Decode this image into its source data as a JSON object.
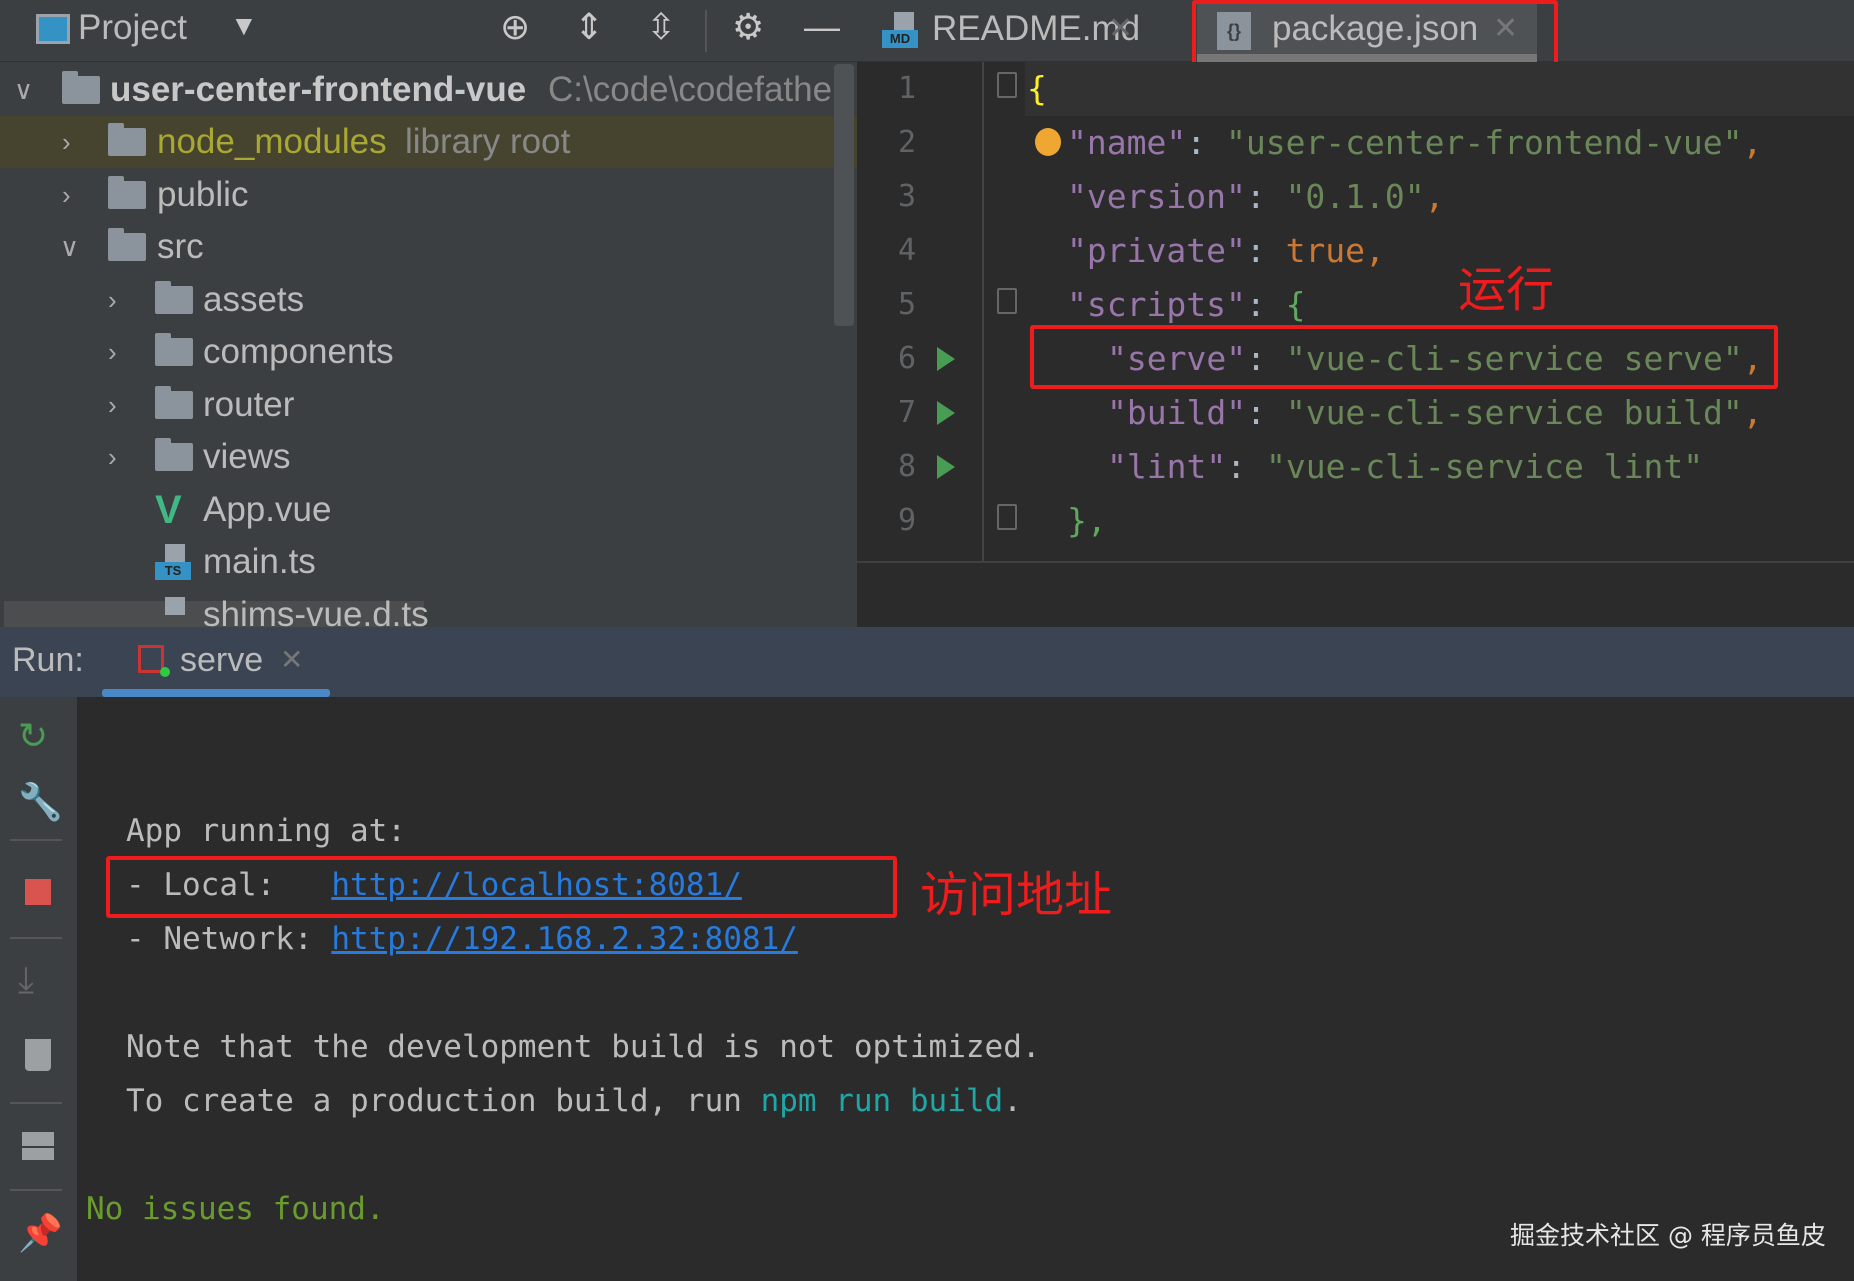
{
  "project_panel": {
    "title": "Project",
    "toolbar_icons": [
      "locate-icon",
      "expand-all-icon",
      "collapse-all-icon",
      "gear-icon",
      "minimize-icon"
    ],
    "tree": [
      {
        "label": "user-center-frontend-vue",
        "hint": "C:\\code\\codefather",
        "type": "folder",
        "expanded": true,
        "level": 0
      },
      {
        "label": "node_modules",
        "hint": "library root",
        "type": "folder",
        "expanded": false,
        "level": 1
      },
      {
        "label": "public",
        "type": "folder",
        "expanded": false,
        "level": 1
      },
      {
        "label": "src",
        "type": "folder",
        "expanded": true,
        "level": 1
      },
      {
        "label": "assets",
        "type": "folder",
        "expanded": false,
        "level": 2
      },
      {
        "label": "components",
        "type": "folder",
        "expanded": false,
        "level": 2
      },
      {
        "label": "router",
        "type": "folder",
        "expanded": false,
        "level": 2
      },
      {
        "label": "views",
        "type": "folder",
        "expanded": false,
        "level": 2
      },
      {
        "label": "App.vue",
        "type": "vue",
        "level": 2
      },
      {
        "label": "main.ts",
        "type": "ts",
        "level": 2
      },
      {
        "label": "shims-vue.d.ts",
        "type": "ts",
        "level": 2
      }
    ]
  },
  "editor": {
    "tabs": [
      {
        "label": "README.md",
        "icon": "MD",
        "active": false
      },
      {
        "label": "package.json",
        "icon": "{}",
        "active": true
      }
    ],
    "line_numbers": [
      "1",
      "2",
      "3",
      "4",
      "5",
      "6",
      "7",
      "8",
      "9"
    ],
    "code": {
      "l1": "{",
      "l2k": "\"name\"",
      "l2v": "\"user-center-frontend-vue\"",
      "l3k": "\"version\"",
      "l3v": "\"0.1.0\"",
      "l4k": "\"private\"",
      "l4v": "true",
      "l5k": "\"scripts\"",
      "l5v": "{",
      "l6k": "\"serve\"",
      "l6v": "\"vue-cli-service serve\"",
      "l7k": "\"build\"",
      "l7v": "\"vue-cli-service build\"",
      "l8k": "\"lint\"",
      "l8v": "\"vue-cli-service lint\"",
      "l9": "},"
    },
    "annotation": "运行"
  },
  "run_panel": {
    "label": "Run:",
    "tab": "serve",
    "side_icons": [
      "rerun-icon",
      "wrench-icon",
      "stop-icon",
      "scroll-to-end-icon",
      "trash-icon",
      "layout-icon",
      "pin-icon"
    ],
    "console": {
      "line1": "App running at:",
      "local_label": "- Local:   ",
      "local_url": "http://localhost:8081/",
      "network_label": "- Network: ",
      "network_url": "http://192.168.2.32:8081/",
      "note": "Note that the development build is not optimized.",
      "prod_prefix": "To create a production build, run ",
      "prod_cmd": "npm run build",
      "prod_suffix": ".",
      "status": "No issues found."
    },
    "annotation": "访问地址"
  },
  "watermark": "掘金技术社区 @ 程序员鱼皮",
  "colors": {
    "accent_red": "#ee1c1c",
    "link": "#287bde",
    "run_green": "#499c54"
  }
}
